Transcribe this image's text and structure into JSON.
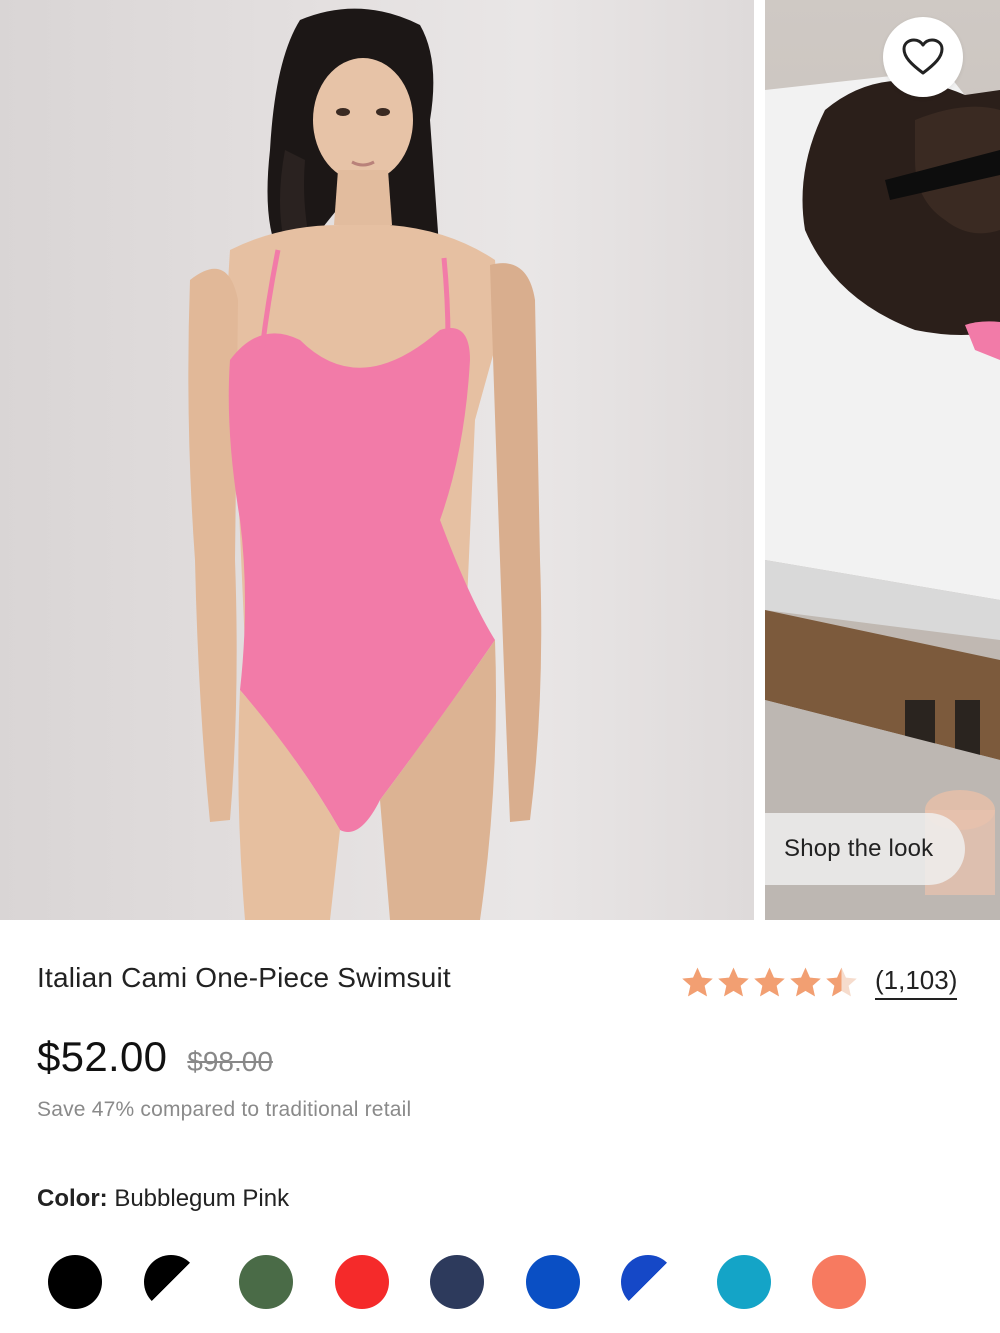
{
  "gallery": {
    "main_image_alt": "Model wearing pink one-piece swimsuit",
    "secondary_image_alt": "Model lounging on towel in pink swimsuit",
    "favorite_icon": "heart-outline-icon",
    "shop_the_look_label": "Shop the look"
  },
  "product": {
    "title": "Italian Cami One-Piece Swimsuit",
    "rating": 4.5,
    "rating_max": 5,
    "review_count": "(1,103)",
    "star_color": "#F29F72",
    "price": "$52.00",
    "original_price": "$98.00",
    "savings_text": "Save 47% compared to traditional retail"
  },
  "color": {
    "label": "Color:",
    "selected": "Bubblegum Pink",
    "swatches": [
      {
        "color": "#000000",
        "style": "solid"
      },
      {
        "color": "#000000",
        "style": "half"
      },
      {
        "color": "#4a6b47",
        "style": "solid"
      },
      {
        "color": "#f52a2a",
        "style": "solid"
      },
      {
        "color": "#2d3a5c",
        "style": "solid"
      },
      {
        "color": "#0a4fc4",
        "style": "solid"
      },
      {
        "color": "#1548c7",
        "style": "half"
      },
      {
        "color": "#14a4c7",
        "style": "solid"
      },
      {
        "color": "#f77a60",
        "style": "solid"
      }
    ]
  }
}
